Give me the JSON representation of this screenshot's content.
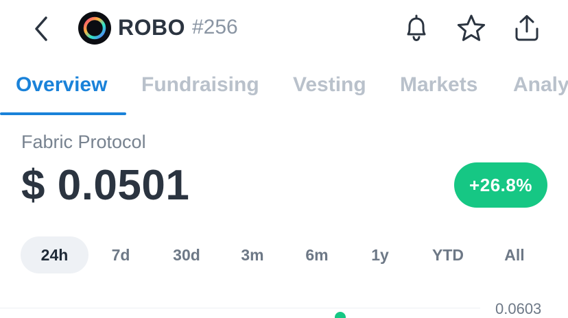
{
  "header": {
    "symbol": "ROBO",
    "rank": "#256",
    "icons": {
      "back": "back-chevron-icon",
      "logo": "fabric-protocol-logo-icon",
      "bell": "bell-icon",
      "star": "star-icon",
      "share": "share-icon"
    }
  },
  "tabs": [
    {
      "label": "Overview",
      "active": true
    },
    {
      "label": "Fundraising",
      "active": false
    },
    {
      "label": "Vesting",
      "active": false
    },
    {
      "label": "Markets",
      "active": false
    },
    {
      "label": "Analy",
      "active": false
    }
  ],
  "coin": {
    "name": "Fabric Protocol",
    "price": "$ 0.0501",
    "change": "+26.8%"
  },
  "ranges": [
    {
      "label": "24h",
      "selected": true
    },
    {
      "label": "7d",
      "selected": false
    },
    {
      "label": "30d",
      "selected": false
    },
    {
      "label": "3m",
      "selected": false
    },
    {
      "label": "6m",
      "selected": false
    },
    {
      "label": "1y",
      "selected": false
    },
    {
      "label": "YTD",
      "selected": false
    },
    {
      "label": "All",
      "selected": false
    }
  ],
  "chart": {
    "axis_max_label": "0.0603"
  },
  "colors": {
    "accent": "#1a82d9",
    "positive": "#16c784",
    "text_primary": "#2b3440",
    "text_muted": "#b9c1cb"
  }
}
